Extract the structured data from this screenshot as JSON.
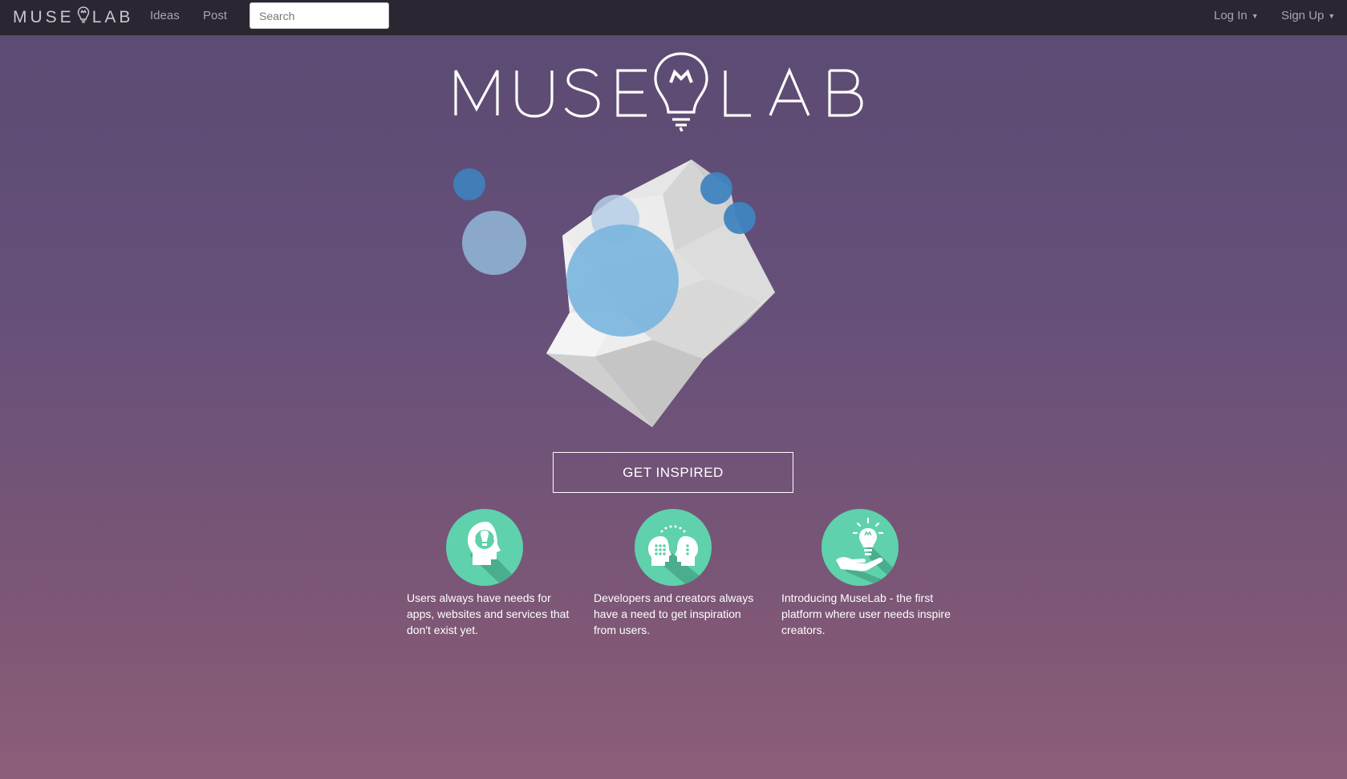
{
  "brand": {
    "left": "MUSE",
    "right": "LAB",
    "icon": "lightbulb-icon"
  },
  "nav": {
    "ideas": "Ideas",
    "post": "Post",
    "login": "Log In",
    "signup": "Sign Up"
  },
  "search": {
    "placeholder": "Search",
    "value": ""
  },
  "hero": {
    "logo_left": "MUSE",
    "logo_right": "LAB",
    "cta": "GET INSPIRED"
  },
  "features": [
    {
      "icon": "head-idea-icon",
      "text": "Users always have needs for apps, websites and services that don't exist yet."
    },
    {
      "icon": "two-heads-icon",
      "text": "Developers and creators always have a need to get inspiration from users."
    },
    {
      "icon": "hand-bulb-icon",
      "text": "Introducing MuseLab - the first platform where user needs inspire creators."
    }
  ],
  "colors": {
    "navbar": "#2c2633",
    "feature_circle": "#5fd1ac",
    "bubble_blue": "#3f84c0",
    "bubble_light": "#7fb6df"
  }
}
